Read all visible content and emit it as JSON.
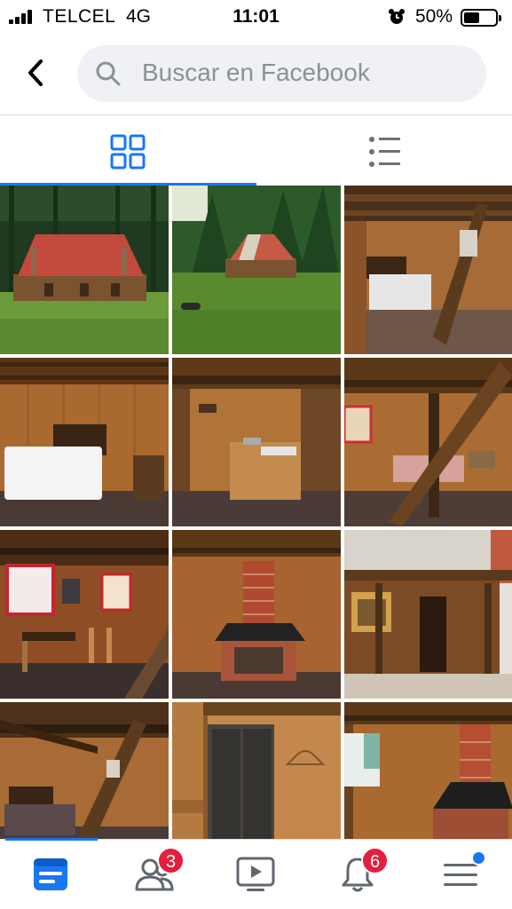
{
  "status_bar": {
    "carrier": "TELCEL",
    "network": "4G",
    "time": "11:01",
    "battery_percent": "50%",
    "battery_level": 0.5,
    "icons": [
      "signal-icon",
      "alarm-icon",
      "battery-icon"
    ]
  },
  "header": {
    "back_icon": "back-arrow-icon",
    "search_placeholder": "Buscar en Facebook",
    "search_icon": "search-icon"
  },
  "view_tabs": [
    {
      "name": "grid-view",
      "icon": "grid-icon",
      "active": true
    },
    {
      "name": "list-view",
      "icon": "list-icon",
      "active": false
    }
  ],
  "photos": [
    {
      "subject": "cabin with red roof in meadow"
    },
    {
      "subject": "cabin among pine trees, green lawn"
    },
    {
      "subject": "bedroom with ladder"
    },
    {
      "subject": "bedroom with white bed"
    },
    {
      "subject": "kitchenette with sink"
    },
    {
      "subject": "room with diagonal beam and bed"
    },
    {
      "subject": "dining area with windows"
    },
    {
      "subject": "brick fireplace"
    },
    {
      "subject": "cabin porch exterior"
    },
    {
      "subject": "bedroom with ladder and beam"
    },
    {
      "subject": "wooden wardrobe doors"
    },
    {
      "subject": "corner fireplace with window"
    }
  ],
  "bottom_nav": [
    {
      "name": "feed",
      "icon": "news-feed-icon",
      "active": true
    },
    {
      "name": "friends",
      "icon": "friends-icon",
      "badge": "3"
    },
    {
      "name": "watch",
      "icon": "video-icon"
    },
    {
      "name": "notifications",
      "icon": "bell-icon",
      "badge": "6"
    },
    {
      "name": "menu",
      "icon": "menu-icon",
      "dot": true
    }
  ],
  "colors": {
    "accent": "#1877f2",
    "badge": "#e41e3f",
    "search_bg": "#eff1f4",
    "placeholder": "#8c9097"
  }
}
